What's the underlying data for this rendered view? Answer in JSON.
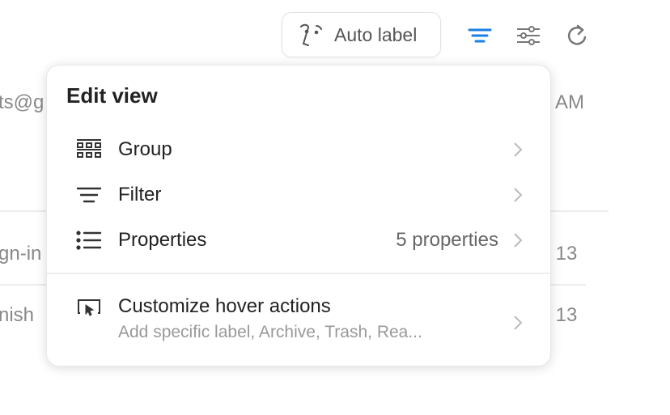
{
  "toolbar": {
    "auto_label": "Auto label",
    "accent": "#1a7fe6"
  },
  "background": {
    "email_fragment": "ts@g",
    "time_fragment": "AM",
    "row1_fragment": "gn-in",
    "row1_date": "r 13",
    "row2_fragment": "nish",
    "row2_date": "r 13"
  },
  "menu": {
    "title": "Edit view",
    "items": [
      {
        "label": "Group",
        "icon": "group-grid-icon"
      },
      {
        "label": "Filter",
        "icon": "filter-icon"
      },
      {
        "label": "Properties",
        "value": "5 properties",
        "icon": "list-icon"
      },
      {
        "label": "Customize hover actions",
        "sub": "Add specific label, Archive, Trash, Rea...",
        "icon": "hover-cursor-icon"
      }
    ]
  }
}
